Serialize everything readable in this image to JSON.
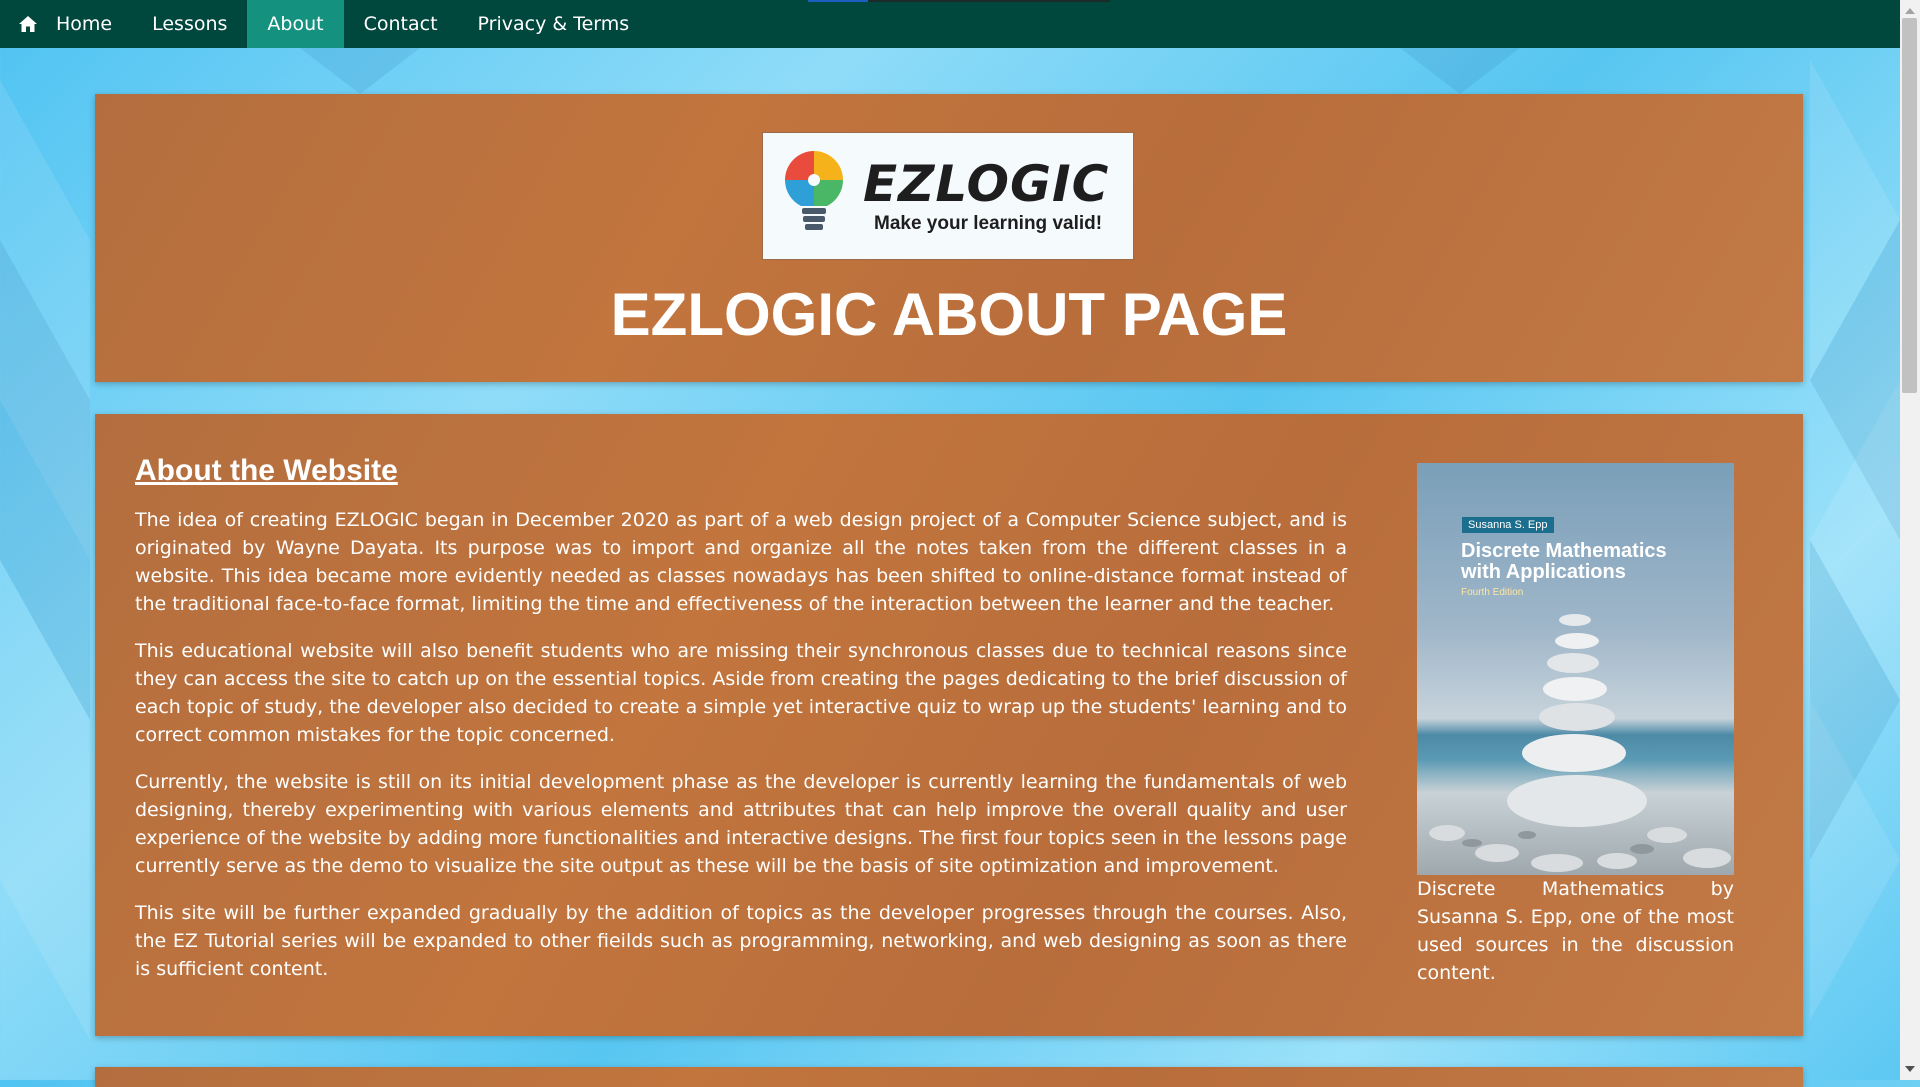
{
  "nav": {
    "items": [
      {
        "label": "Home",
        "icon": "home-icon"
      },
      {
        "label": "Lessons"
      },
      {
        "label": "About"
      },
      {
        "label": "Contact"
      },
      {
        "label": "Privacy & Terms"
      }
    ],
    "active": "About"
  },
  "header": {
    "logo_text": "EZLOGIC",
    "logo_tagline": "Make your learning valid!",
    "title": "EZLOGIC ABOUT PAGE"
  },
  "about": {
    "heading": "About the Website",
    "paragraphs": [
      "The idea of creating EZLOGIC began in December 2020 as part of a web design project of a Computer Science subject, and is originated by Wayne Dayata. Its purpose was to import and organize all the notes taken from the different classes in a website. This idea became more evidently needed as classes nowadays has been shifted to online-distance format instead of the traditional face-to-face format, limiting the time and effectiveness of the interaction between the learner and the teacher.",
      "This educational website will also benefit students who are missing their synchronous classes due to technical reasons since they can access the site to catch up on the essential topics. Aside from creating the pages dedicating to the brief discussion of each topic of study, the developer also decided to create a simple yet interactive quiz to wrap up the students' learning and to correct common mistakes for the topic concerned.",
      "Currently, the website is still on its initial development phase as the developer is currently learning the fundamentals of web designing, thereby experimenting with various elements and attributes that can help improve the overall quality and user experience of the website by adding more functionalities and interactive designs. The first four topics seen in the lessons page currently serve as the demo to visualize the site output as these will be the basis of site optimization and improvement.",
      "This site will be further expanded gradually by the addition of topics as the developer progresses through the courses. Also, the EZ Tutorial series will be expanded to other fieilds such as programming, networking, and web designing as soon as there is sufficient content."
    ],
    "book": {
      "author_tag": "Susanna S. Epp",
      "title": "Discrete Mathematics with Applications",
      "edition": "Fourth Edition"
    },
    "caption": "Discrete Mathematics by Susanna S. Epp, one of the most used sources in the discussion content."
  },
  "colors": {
    "navbar": "#00473e",
    "nav_active": "#14917f",
    "panel": "#c2753d",
    "text": "#ffffff"
  }
}
